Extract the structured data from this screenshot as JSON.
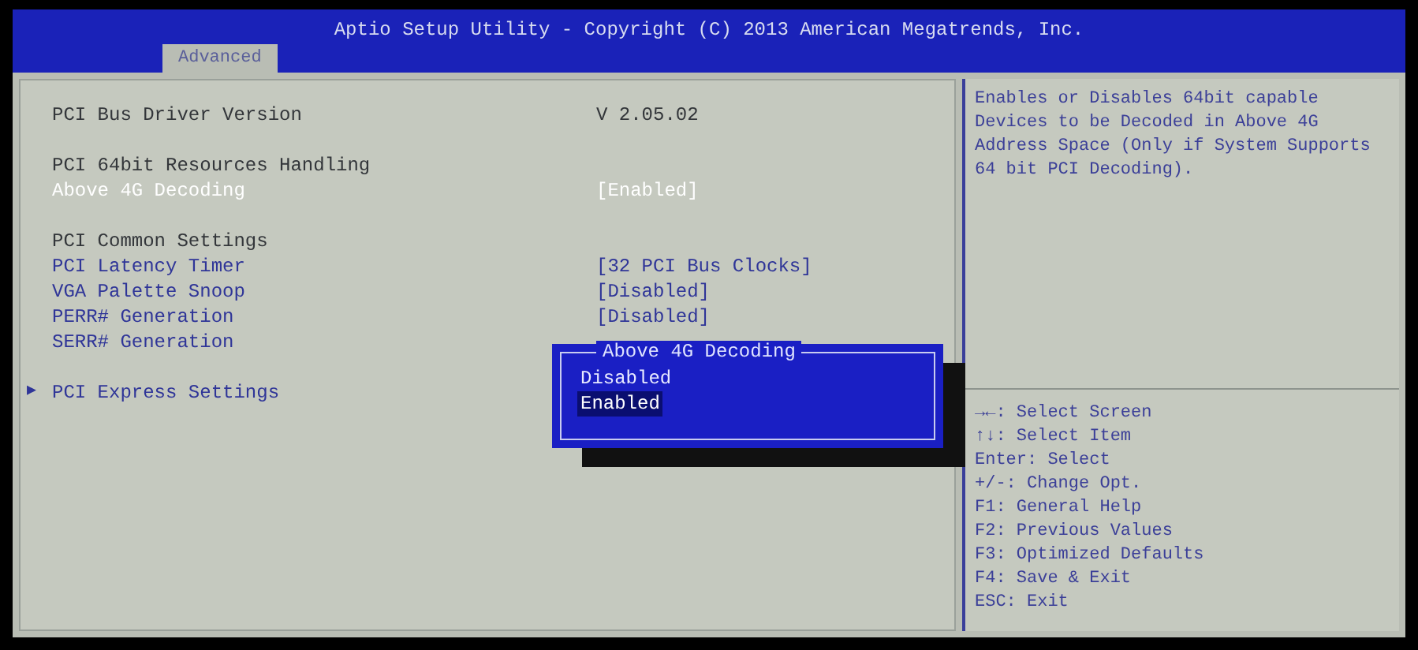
{
  "window": {
    "title": "Aptio Setup Utility - Copyright (C) 2013 American Megatrends, Inc."
  },
  "tabs": [
    {
      "label": "Advanced",
      "selected": true
    }
  ],
  "items": [
    {
      "kind": "info",
      "label": "PCI Bus Driver Version",
      "value": "V 2.05.02",
      "selected": false
    },
    {
      "kind": "gap"
    },
    {
      "kind": "heading",
      "label": "PCI 64bit Resources Handling",
      "selected": false
    },
    {
      "kind": "setting",
      "label": "Above 4G Decoding",
      "value": "[Enabled]",
      "selected": true
    },
    {
      "kind": "gap"
    },
    {
      "kind": "heading",
      "label": "PCI Common Settings",
      "selected": false
    },
    {
      "kind": "setting",
      "label": "PCI Latency Timer",
      "value": "[32 PCI Bus Clocks]",
      "selected": false
    },
    {
      "kind": "setting",
      "label": "VGA Palette Snoop",
      "value": "[Disabled]",
      "selected": false
    },
    {
      "kind": "setting",
      "label": "PERR# Generation",
      "value": "[Disabled]",
      "selected": false
    },
    {
      "kind": "setting",
      "label": "SERR# Generation",
      "selected": false
    },
    {
      "kind": "gap"
    },
    {
      "kind": "submenu",
      "marker": "▶",
      "label": "PCI Express Settings",
      "selected": false
    }
  ],
  "popup": {
    "title": "Above 4G Decoding",
    "options": [
      {
        "label": "Disabled",
        "selected": false
      },
      {
        "label": "Enabled",
        "selected": true
      }
    ]
  },
  "help_text": "Enables or Disables 64bit capable Devices to be Decoded in Above 4G Address Space (Only if System Supports 64 bit PCI Decoding).",
  "key_help": [
    "→←: Select Screen",
    "↑↓: Select Item",
    "Enter: Select",
    "+/-: Change Opt.",
    "F1: General Help",
    "F2: Previous Values",
    "F3: Optimized Defaults",
    "F4: Save & Exit",
    "ESC: Exit"
  ]
}
